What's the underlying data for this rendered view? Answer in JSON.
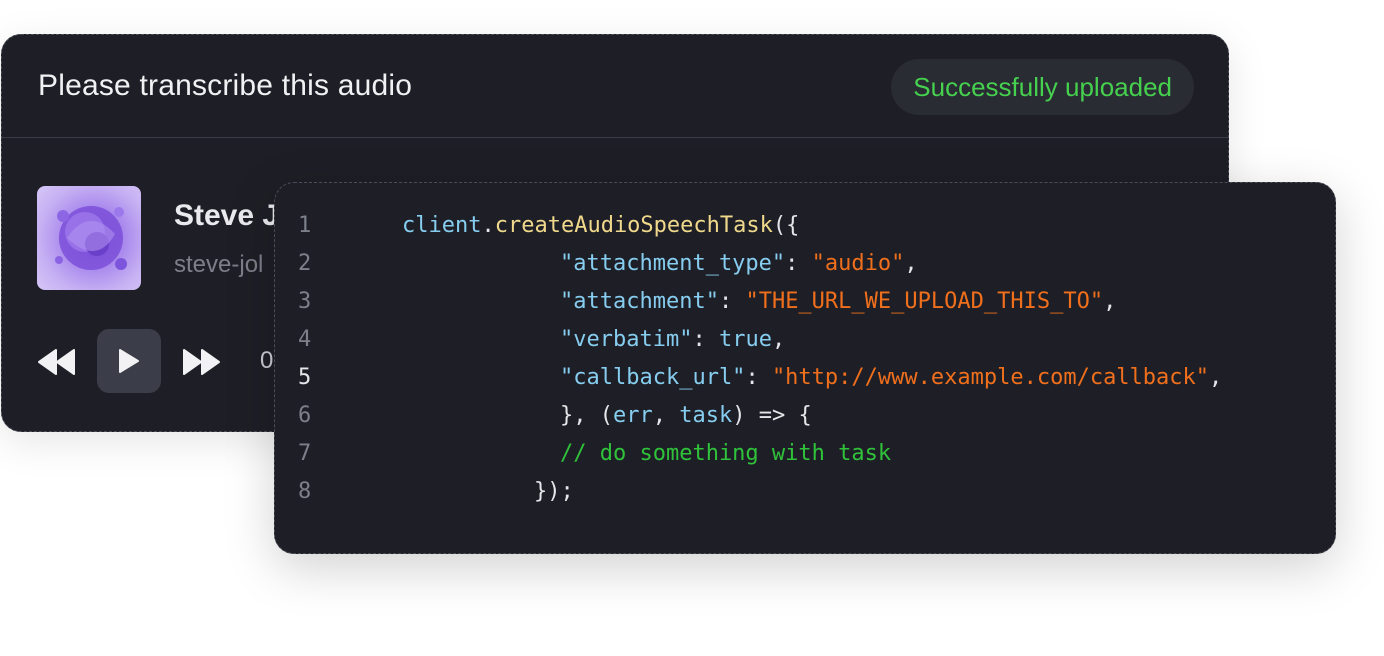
{
  "audio_card": {
    "title": "Please transcribe this audio",
    "status": "Successfully uploaded",
    "track_name": "Steve J",
    "track_file": "steve-jol",
    "time_current": "0"
  },
  "colors": {
    "background": "#ffffff",
    "card": "#1e1f26",
    "status_green": "#45d04e",
    "string_orange": "#f06f1c",
    "keyword_blue": "#86cdf0",
    "function_yellow": "#f0d98c",
    "comment_green": "#2fc23a"
  },
  "icons": {
    "rewind": "rewind-icon",
    "play": "play-icon",
    "forward": "fast-forward-icon",
    "album": "album-art-image"
  },
  "code": {
    "active_line": 5,
    "lines": [
      {
        "n": "1",
        "tokens": [
          {
            "t": "client",
            "c": "id"
          },
          {
            "t": ".",
            "c": "punc"
          },
          {
            "t": "createAudioSpeechTask",
            "c": "fn"
          },
          {
            "t": "({",
            "c": "punc"
          }
        ]
      },
      {
        "n": "2",
        "tokens": [
          {
            "t": "\"attachment_type\"",
            "c": "key"
          },
          {
            "t": ": ",
            "c": "punc"
          },
          {
            "t": "\"audio\"",
            "c": "str"
          },
          {
            "t": ",",
            "c": "punc"
          }
        ]
      },
      {
        "n": "3",
        "tokens": [
          {
            "t": "\"attachment\"",
            "c": "key"
          },
          {
            "t": ": ",
            "c": "punc"
          },
          {
            "t": "\"THE_URL_WE_UPLOAD_THIS_TO\"",
            "c": "str"
          },
          {
            "t": ",",
            "c": "punc"
          }
        ]
      },
      {
        "n": "4",
        "tokens": [
          {
            "t": "\"verbatim\"",
            "c": "key"
          },
          {
            "t": ": ",
            "c": "punc"
          },
          {
            "t": "true",
            "c": "bool"
          },
          {
            "t": ",",
            "c": "punc"
          }
        ]
      },
      {
        "n": "5",
        "tokens": [
          {
            "t": "\"callback_url\"",
            "c": "key"
          },
          {
            "t": ": ",
            "c": "punc"
          },
          {
            "t": "\"http://www.example.com/callback\"",
            "c": "str"
          },
          {
            "t": ",",
            "c": "punc"
          }
        ]
      },
      {
        "n": "6",
        "tokens": [
          {
            "t": "}, (",
            "c": "punc"
          },
          {
            "t": "err",
            "c": "id"
          },
          {
            "t": ", ",
            "c": "punc"
          },
          {
            "t": "task",
            "c": "id"
          },
          {
            "t": ") => {",
            "c": "punc"
          }
        ]
      },
      {
        "n": "7",
        "tokens": [
          {
            "t": "// do something with task",
            "c": "cmt"
          }
        ]
      },
      {
        "n": "8",
        "tokens": [
          {
            "t": "});",
            "c": "punc"
          }
        ]
      }
    ]
  }
}
